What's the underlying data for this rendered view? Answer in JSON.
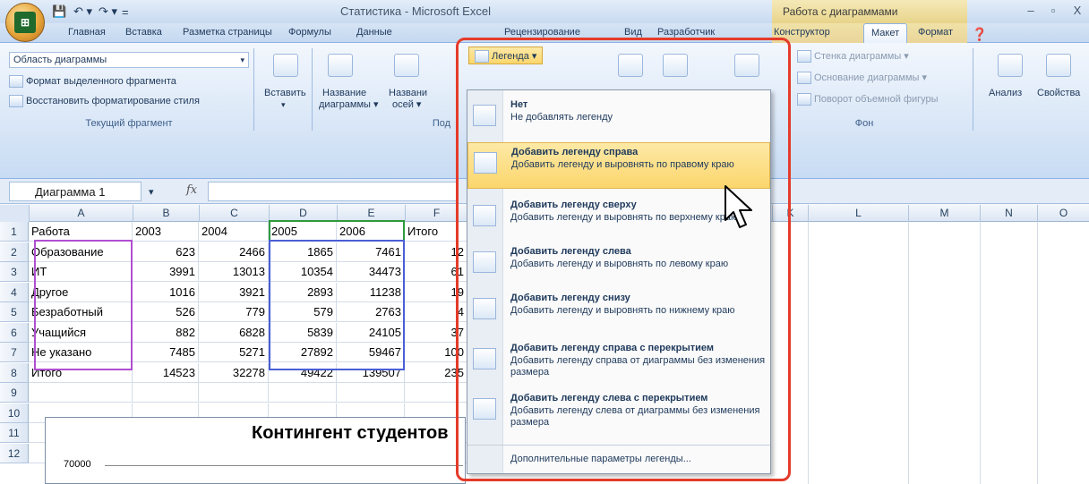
{
  "window": {
    "title": "Статистика - Microsoft Excel",
    "context_header": "Работа с диаграммами",
    "min": "–",
    "restore": "▫",
    "close": "X"
  },
  "qat": {
    "save": "💾",
    "undo": "↶ ▾",
    "redo": "↷ ▾",
    "customize": "="
  },
  "tabs": [
    "Главная",
    "Вставка",
    "Разметка страницы",
    "Формулы",
    "Данные",
    "Рецензирование",
    "Вид",
    "Разработчик",
    "Конструктор",
    "Макет",
    "Формат"
  ],
  "active_tab": "Макет",
  "ribbon": {
    "current_fragment": {
      "selector_value": "Область диаграммы",
      "format_selection": "Формат выделенного фрагмента",
      "reset_style": "Восстановить форматирование стиля",
      "group_label": "Текущий фрагмент"
    },
    "insert": {
      "label": "Вставить"
    },
    "chart_title": {
      "line1": "Название",
      "line2": "диаграммы ▾"
    },
    "axis_titles": {
      "line1": "Названи",
      "line2": "осей ▾"
    },
    "labels_group": "Под",
    "legend_button": "Легенда ▾",
    "background": {
      "chart_wall": "Стенка диаграммы ▾",
      "chart_floor": "Основание диаграммы ▾",
      "rotation_3d": "Поворот объемной фигуры",
      "group_label": "Фон"
    },
    "analysis": "Анализ",
    "properties": "Свойства"
  },
  "formula_bar": {
    "name_box": "Диаграмма 1",
    "fx": "fx"
  },
  "columns": [
    "A",
    "B",
    "C",
    "D",
    "E",
    "F",
    "K",
    "L",
    "M",
    "N",
    "O"
  ],
  "rows": [
    {
      "n": "1",
      "cells": [
        "Работа",
        "2003",
        "2004",
        "2005",
        "2006",
        "Итого"
      ]
    },
    {
      "n": "2",
      "cells": [
        "Образование",
        "623",
        "2466",
        "1865",
        "7461",
        "12"
      ]
    },
    {
      "n": "3",
      "cells": [
        "ИТ",
        "3991",
        "13013",
        "10354",
        "34473",
        "61"
      ]
    },
    {
      "n": "4",
      "cells": [
        "Другое",
        "1016",
        "3921",
        "2893",
        "11238",
        "19"
      ]
    },
    {
      "n": "5",
      "cells": [
        "Безработный",
        "526",
        "779",
        "579",
        "2763",
        "4"
      ]
    },
    {
      "n": "6",
      "cells": [
        "Учащийся",
        "882",
        "6828",
        "5839",
        "24105",
        "37"
      ]
    },
    {
      "n": "7",
      "cells": [
        "Не указано",
        "7485",
        "5271",
        "27892",
        "59467",
        "100"
      ]
    },
    {
      "n": "8",
      "cells": [
        "Итого",
        "14523",
        "32278",
        "49422",
        "139507",
        "235"
      ]
    },
    {
      "n": "9",
      "cells": []
    },
    {
      "n": "10",
      "cells": []
    },
    {
      "n": "11",
      "cells": []
    },
    {
      "n": "12",
      "cells": []
    }
  ],
  "chart": {
    "title": "Контингент студентов",
    "y_tick": "70000"
  },
  "legend_menu": {
    "items": [
      {
        "title": "Нет",
        "desc": "Не добавлять легенду"
      },
      {
        "title": "Добавить легенду справа",
        "desc": "Добавить легенду и выровнять по правому краю"
      },
      {
        "title": "Добавить легенду сверху",
        "desc": "Добавить легенду и выровнять по верхнему краю"
      },
      {
        "title": "Добавить легенду слева",
        "desc": "Добавить легенду и выровнять по левому краю"
      },
      {
        "title": "Добавить легенду снизу",
        "desc": "Добавить легенду и выровнять по нижнему краю"
      },
      {
        "title": "Добавить легенду справа с перекрытием",
        "desc": "Добавить легенду справа от диаграммы без изменения размера"
      },
      {
        "title": "Добавить легенду слева с перекрытием",
        "desc": "Добавить легенду слева от диаграммы без изменения размера"
      }
    ],
    "more": "Дополнительные параметры легенды..."
  },
  "colors": {
    "highlight": "#e53b2b",
    "selected_item": "#fbd66c",
    "ribbon": "#d5e4f6"
  }
}
